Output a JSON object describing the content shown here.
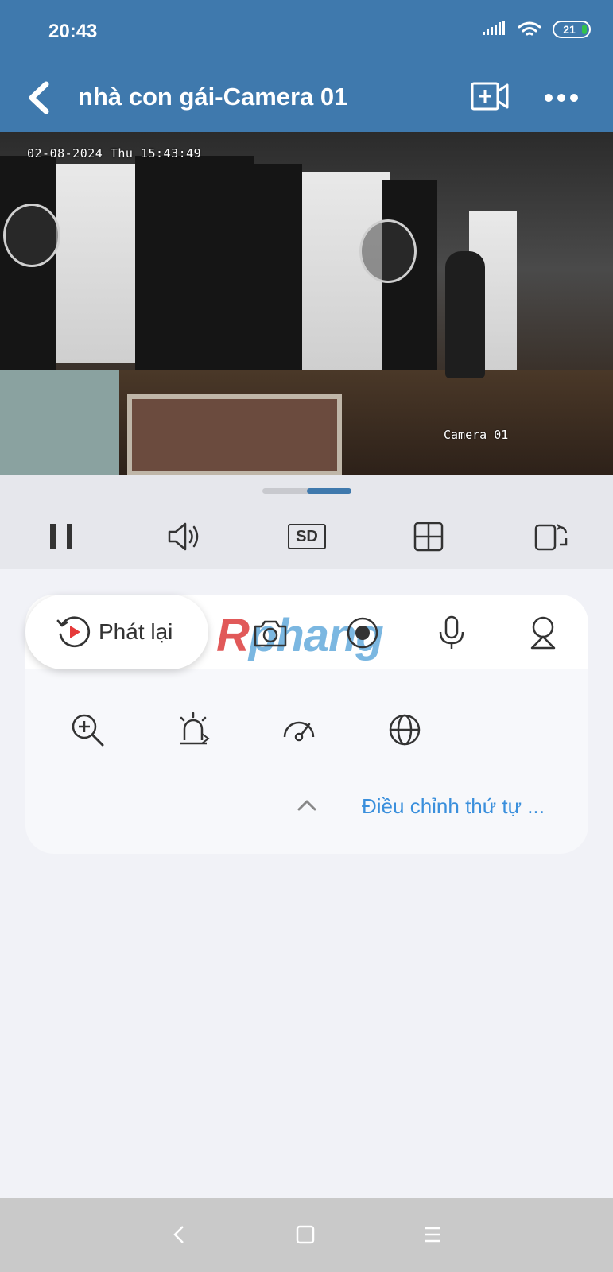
{
  "status_bar": {
    "time": "20:43",
    "battery": "21"
  },
  "nav": {
    "title": "nhà con gái-Camera 01"
  },
  "video": {
    "timestamp": "02-08-2024 Thu 15:43:49",
    "camera_label": "Camera 01"
  },
  "controls": {
    "items": [
      "pause-icon",
      "volume-icon",
      "sd-quality-icon",
      "grid-layout-icon",
      "rotate-screen-icon"
    ],
    "quality_label": "SD"
  },
  "panel": {
    "playback_label": "Phát lại",
    "watermark": {
      "prefix": "R",
      "rest": "phang"
    },
    "top_tools": [
      "snapshot-icon",
      "record-icon",
      "microphone-icon",
      "ptz-camera-icon"
    ],
    "tools": [
      "zoom-in-icon",
      "alarm-light-icon",
      "speed-gauge-icon",
      "globe-icon"
    ],
    "reorder_label": "Điều chỉnh thứ tự ..."
  },
  "colors": {
    "header": "#3f79ad",
    "link": "#3a8fdc",
    "accent_red": "#e63a3a"
  }
}
